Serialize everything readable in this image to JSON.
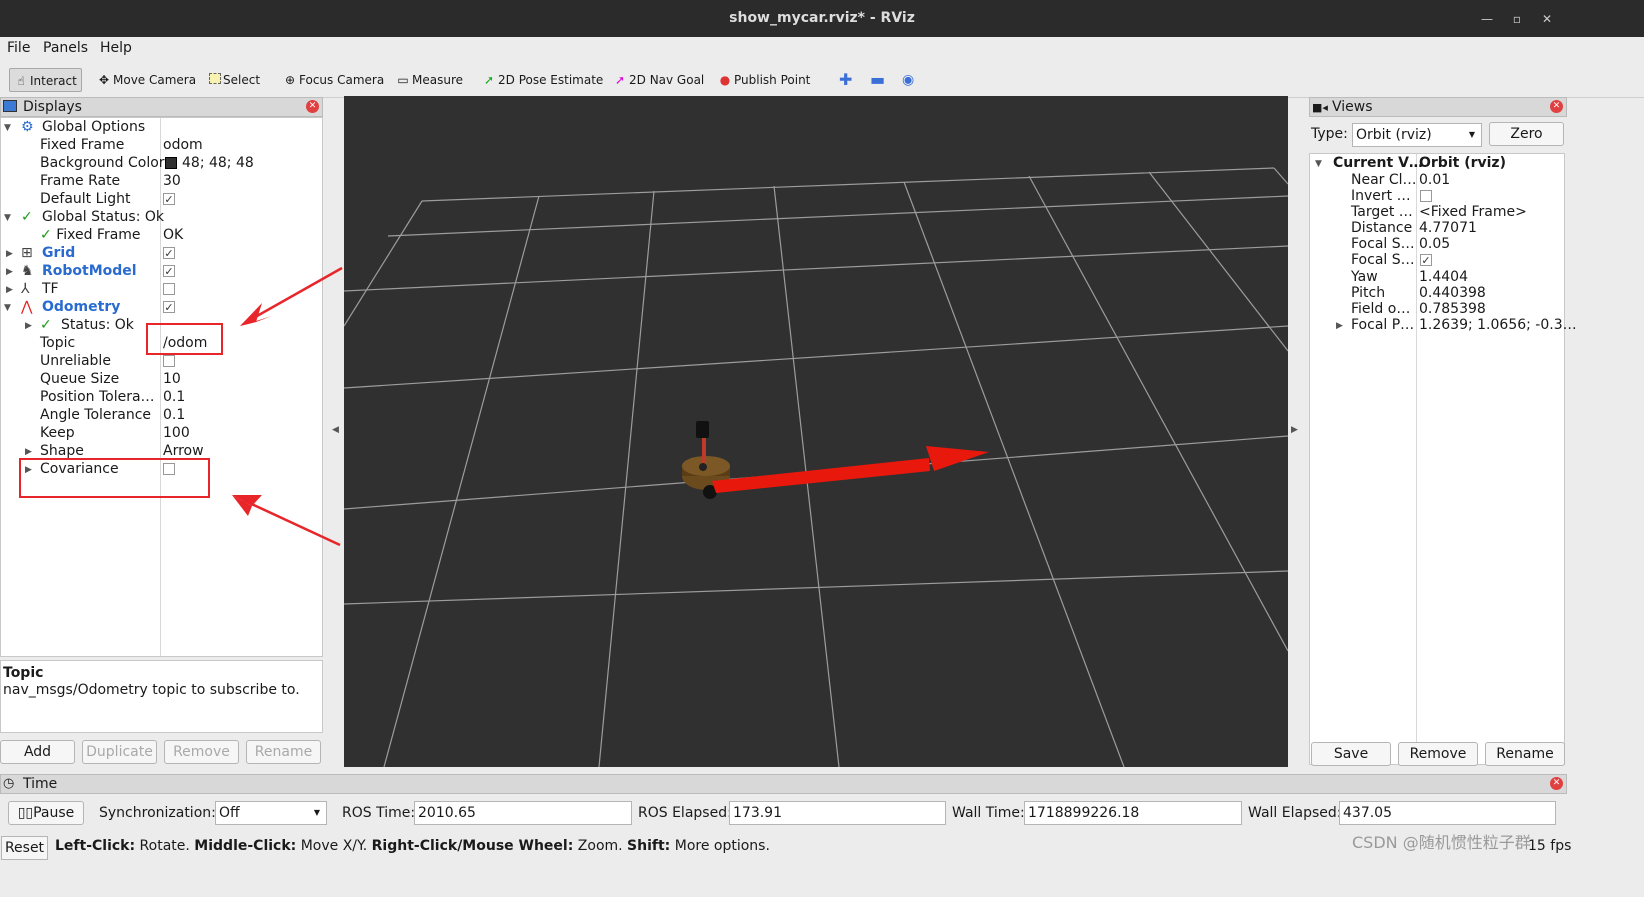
{
  "window": {
    "title": "show_mycar.rviz* - RViz"
  },
  "menu": [
    "File",
    "Panels",
    "Help"
  ],
  "toolbar": {
    "interact": "Interact",
    "move_camera": "Move Camera",
    "select": "Select",
    "focus_camera": "Focus Camera",
    "measure": "Measure",
    "pose_estimate": "2D Pose Estimate",
    "nav_goal": "2D Nav Goal",
    "publish_point": "Publish Point"
  },
  "displays": {
    "title": "Displays",
    "rows": {
      "global_options": "Global Options",
      "fixed_frame": "Fixed Frame",
      "fixed_frame_val": "odom",
      "bg_color": "Background Color",
      "bg_color_val": "48; 48; 48",
      "frame_rate": "Frame Rate",
      "frame_rate_val": "30",
      "default_light": "Default Light",
      "global_status": "Global Status: Ok",
      "gs_fixed_frame": "Fixed Frame",
      "gs_fixed_frame_val": "OK",
      "grid": "Grid",
      "robotmodel": "RobotModel",
      "tf": "TF",
      "odometry": "Odometry",
      "status": "Status: Ok",
      "topic": "Topic",
      "topic_val": "/odom",
      "unreliable": "Unreliable",
      "queue_size": "Queue Size",
      "queue_size_val": "10",
      "position_tol": "Position Tolera…",
      "position_tol_val": "0.1",
      "angle_tol": "Angle Tolerance",
      "angle_tol_val": "0.1",
      "keep": "Keep",
      "keep_val": "100",
      "shape": "Shape",
      "shape_val": "Arrow",
      "covariance": "Covariance"
    },
    "description_title": "Topic",
    "description_text": "nav_msgs/Odometry topic to subscribe to.",
    "buttons": {
      "add": "Add",
      "duplicate": "Duplicate",
      "remove": "Remove",
      "rename": "Rename"
    }
  },
  "views": {
    "title": "Views",
    "type_label": "Type:",
    "type_value": "Orbit (rviz)",
    "zero": "Zero",
    "header_key": "Current V…",
    "header_val": "Orbit (rviz)",
    "props": [
      {
        "k": "Near Cl…",
        "v": "0.01"
      },
      {
        "k": "Invert …",
        "v": ""
      },
      {
        "k": "Target …",
        "v": "<Fixed Frame>"
      },
      {
        "k": "Distance",
        "v": "4.77071"
      },
      {
        "k": "Focal S…",
        "v": "0.05"
      },
      {
        "k": "Focal S…",
        "v": ""
      },
      {
        "k": "Yaw",
        "v": "1.4404"
      },
      {
        "k": "Pitch",
        "v": "0.440398"
      },
      {
        "k": "Field o…",
        "v": "0.785398"
      },
      {
        "k": "Focal P…",
        "v": "1.2639; 1.0656; -0.3…"
      }
    ],
    "buttons": {
      "save": "Save",
      "remove": "Remove",
      "rename": "Rename"
    }
  },
  "time": {
    "title": "Time",
    "pause": "Pause",
    "sync_label": "Synchronization:",
    "sync_value": "Off",
    "ros_time_label": "ROS Time:",
    "ros_time": "2010.65",
    "ros_elapsed_label": "ROS Elapsed:",
    "ros_elapsed": "173.91",
    "wall_time_label": "Wall Time:",
    "wall_time": "1718899226.18",
    "wall_elapsed_label": "Wall Elapsed:",
    "wall_elapsed": "437.05"
  },
  "status": {
    "reset": "Reset",
    "left_click": "Left-Click:",
    "left_click_text": "Rotate.",
    "middle_click": "Middle-Click:",
    "middle_click_text": "Move X/Y.",
    "right_click": "Right-Click/Mouse Wheel:",
    "right_click_text": "Zoom.",
    "shift": "Shift:",
    "shift_text": "More options.",
    "fps": "15 fps",
    "watermark": "CSDN @随机惯性粒子群"
  },
  "colors": {
    "viewport_bg": "#303030",
    "grid": "#a0a0a0",
    "annotation": "#e8262a",
    "accent": "#2a6bd0"
  }
}
